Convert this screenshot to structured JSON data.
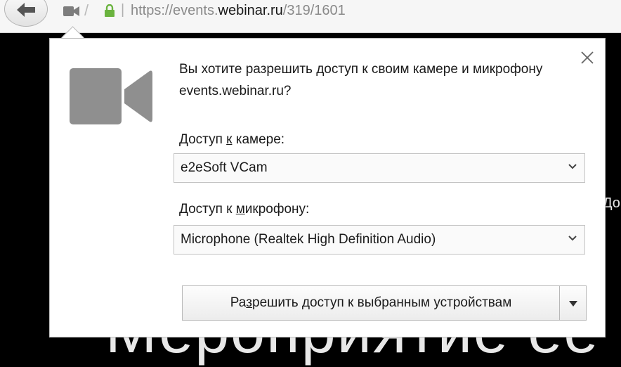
{
  "urlbar": {
    "url_prefix": "https://events.",
    "url_domain": "webinar.ru",
    "url_path": "/319/1601",
    "icons": [
      "back-arrow-icon",
      "camera-icon",
      "lock-icon"
    ]
  },
  "background": {
    "large_text": "Мероприятие ее",
    "side_text": "До"
  },
  "popup": {
    "icon": "video-camera-icon",
    "question": "Вы хотите разрешить доступ к своим камере и микрофону events.webinar.ru?",
    "camera_label_before": "Доступ ",
    "camera_label_accel": "к",
    "camera_label_after": " камере:",
    "camera_selected": "e2eSoft VCam",
    "mic_label_before": "Доступ к ",
    "mic_label_accel": "м",
    "mic_label_after": "икрофону:",
    "mic_selected": "Microphone (Realtek High Definition Audio)",
    "allow_before": "Ра",
    "allow_accel": "з",
    "allow_after": "решить доступ к выбранным устройствам"
  },
  "colors": {
    "lock_green": "#6ab33e",
    "icon_gray": "#8f8f8f",
    "page_background": "#000000"
  }
}
